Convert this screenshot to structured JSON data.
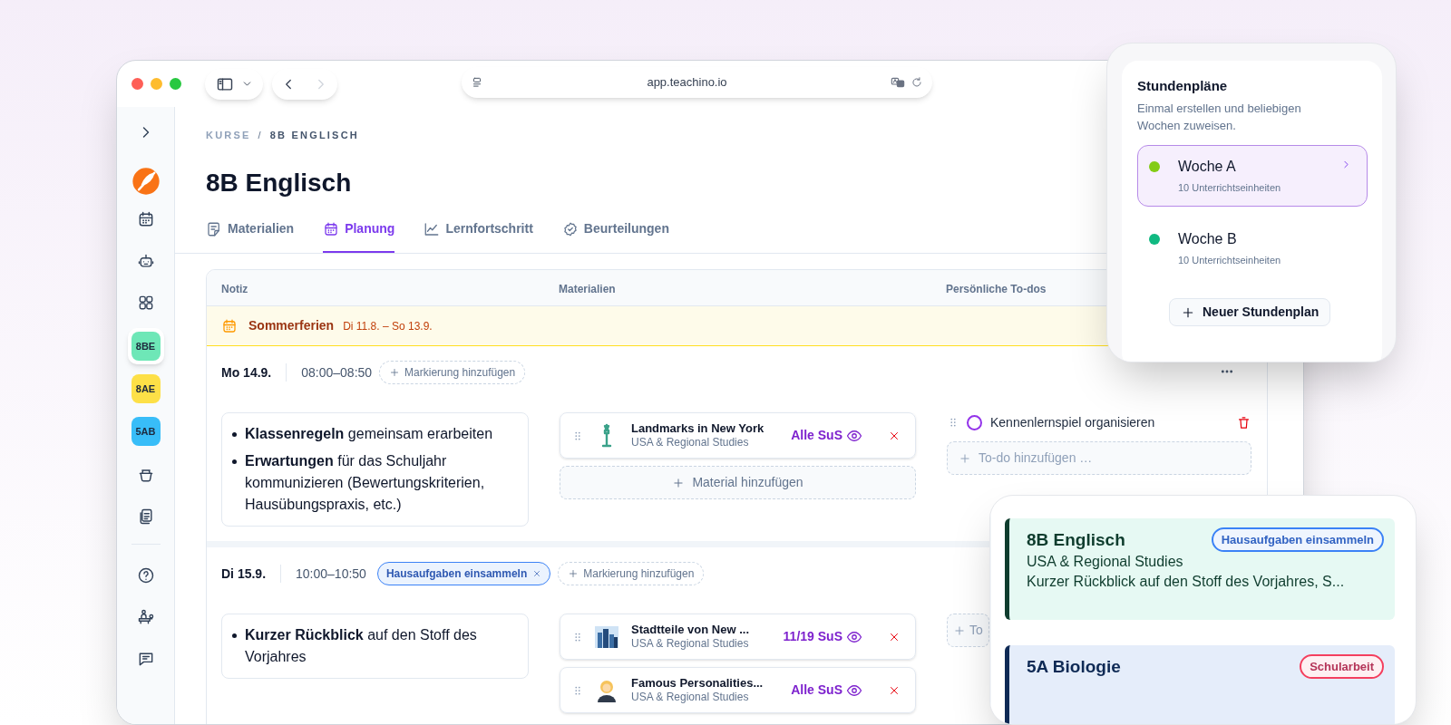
{
  "browser": {
    "url": "app.teachino.io"
  },
  "sidebar": {
    "courses": [
      {
        "label": "8BE",
        "color": "#6ee7b7",
        "selected": true
      },
      {
        "label": "8AE",
        "color": "#fde047",
        "selected": false
      },
      {
        "label": "5AB",
        "color": "#38bdf8",
        "selected": false
      }
    ]
  },
  "breadcrumb": [
    "KURSE",
    "8B ENGLISCH"
  ],
  "breadcrumb_separator": "/",
  "title": "8B Englisch",
  "tabs": [
    {
      "label": "Materialien",
      "selected": false
    },
    {
      "label": "Planung",
      "selected": true
    },
    {
      "label": "Lernfortschritt",
      "selected": false
    },
    {
      "label": "Beurteilungen",
      "selected": false
    }
  ],
  "table": {
    "columns": [
      "Notiz",
      "Materialien",
      "Persönliche To-dos"
    ],
    "holiday": {
      "title": "Sommerferien",
      "dates": "Di 11.8. – So 13.9."
    },
    "lessons": [
      {
        "date": "Mo 14.9.",
        "time": "08:00–08:50",
        "add_marker": "Markierung hinzufügen",
        "notes": [
          "**Klassenregeln** gemeinsam erarbeiten",
          "**Erwartungen** für das Schuljahr kommunizieren (Bewertungskriterien, Hausübungspraxis, etc.)"
        ],
        "materials": [
          {
            "title": "Landmarks in New York",
            "subtitle": "USA & Regional Studies",
            "audience": "Alle SuS"
          }
        ],
        "add_material": "Material hinzufügen",
        "todos": [
          {
            "label": "Kennenlernspiel organisieren",
            "checked": false
          }
        ],
        "add_todo": "To-do hinzufügen …"
      },
      {
        "date": "Di 15.9.",
        "time": "10:00–10:50",
        "markers": [
          {
            "label": "Hausaufgaben einsammeln",
            "color": "#3b82f6"
          }
        ],
        "add_marker": "Markierung hinzufügen",
        "notes": [
          "**Kurzer Rückblick** auf den Stoff des Vorjahres"
        ],
        "materials": [
          {
            "title": "Stadtteile von New ...",
            "subtitle": "USA & Regional Studies",
            "audience": "11/19 SuS"
          },
          {
            "title": "Famous Personalities...",
            "subtitle": "USA & Regional Studies",
            "audience": "Alle SuS"
          }
        ],
        "add_todo": "To"
      }
    ]
  },
  "timetables": {
    "title": "Stundenpläne",
    "description": "Einmal erstellen und beliebigen Wochen zuweisen.",
    "plans": [
      {
        "name": "Woche A",
        "count": "10 Unterrichtseinheiten",
        "color": "#84cc16",
        "selected": true
      },
      {
        "name": "Woche B",
        "count": "10 Unterrichtseinheiten",
        "color": "#10b981",
        "selected": false
      }
    ],
    "button": "Neuer Stundenplan"
  },
  "calendar": {
    "events": [
      {
        "title": "8B Englisch",
        "color": "#0f3d2e",
        "tag": {
          "label": "Hausaufgaben einsammeln",
          "color": "#3b82f6"
        },
        "lines": [
          "USA & Regional Studies",
          "Kurzer Rückblick auf den Stoff des Vorjahres, S..."
        ]
      },
      {
        "title": "5A Biologie",
        "color": "#0f2a55",
        "tag": {
          "label": "Schularbeit",
          "color": "#f43f5e"
        }
      }
    ]
  }
}
